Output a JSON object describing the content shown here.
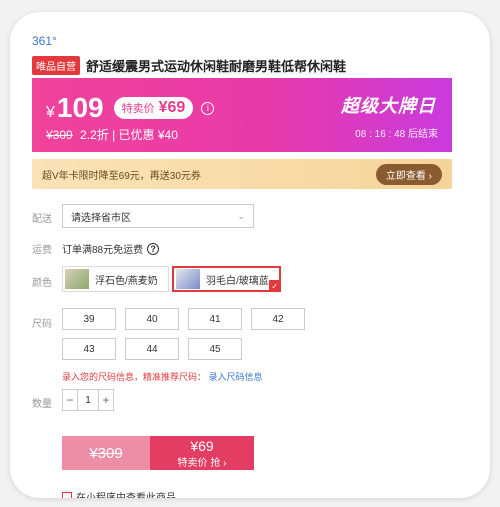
{
  "brand": "361°",
  "product": {
    "tag": "唯品自营",
    "title": "舒适缓震男式运动休闲鞋耐磨男鞋低帮休闲鞋"
  },
  "banner": {
    "currency": "¥",
    "price": "109",
    "special_label": "特卖价",
    "special_price": "¥69",
    "original_price": "¥309",
    "discount": "2.2折",
    "saved": "| 已优惠 ¥40",
    "event_name": "超级大牌日",
    "countdown": "08 : 16 : 48  后结束",
    "colors": {
      "start": "#f0439a",
      "end": "#c93bdc"
    }
  },
  "promo": {
    "text": "超V年卡限时降至69元，再送30元券",
    "button": "立即查看 ›"
  },
  "delivery": {
    "label": "配送",
    "placeholder": "请选择省市区"
  },
  "shipping": {
    "label": "运费",
    "text": "订单满88元免运费"
  },
  "color": {
    "label": "颜色",
    "options": [
      {
        "name": "浮石色/燕麦奶",
        "selected": false
      },
      {
        "name": "羽毛白/玻璃蓝",
        "selected": true
      }
    ]
  },
  "size": {
    "label": "尺码",
    "options": [
      "39",
      "40",
      "41",
      "42",
      "43",
      "44",
      "45"
    ],
    "hint": "录入您的尺码信息，精准推荐尺码：",
    "hint_link": "录入尺码信息"
  },
  "quantity": {
    "label": "数量",
    "value": "1",
    "minus": "−",
    "plus": "+"
  },
  "buy": {
    "original": "¥309",
    "price": "¥69",
    "label": "特卖价 抢 ›"
  },
  "mini_program": {
    "text": "在小程序中查看此商品"
  }
}
